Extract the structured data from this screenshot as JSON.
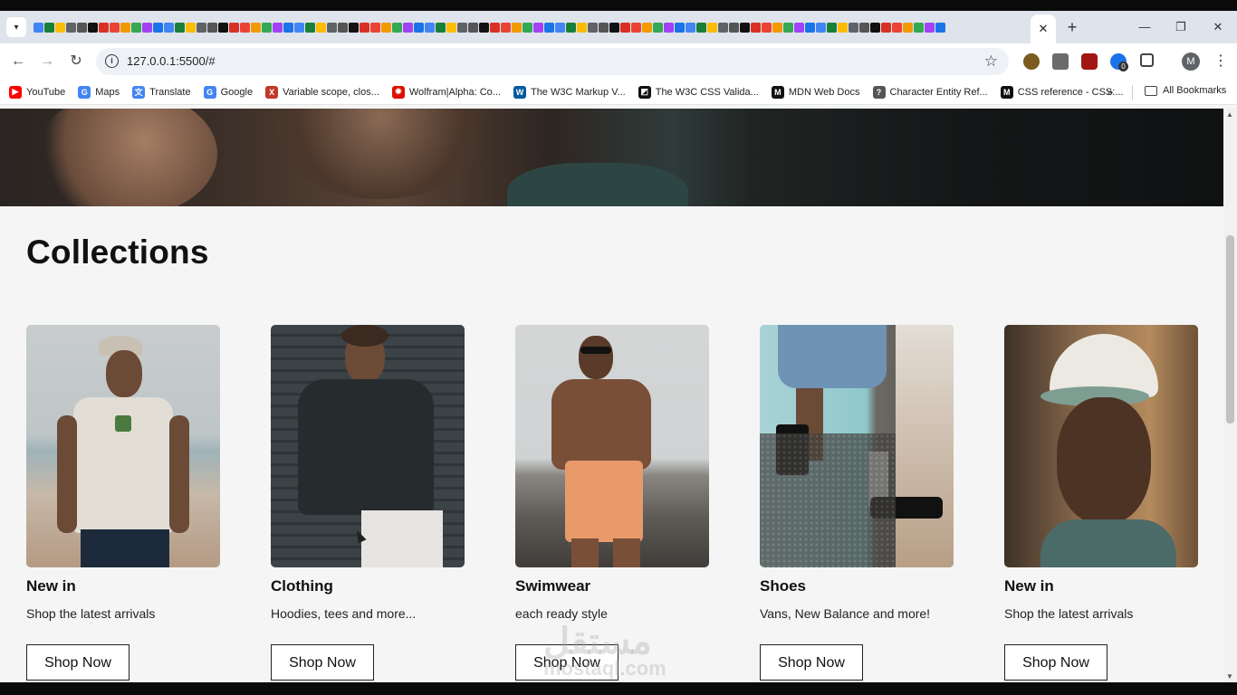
{
  "browser": {
    "active_tab_close": "✕",
    "new_tab": "+",
    "window_controls": {
      "minimize": "—",
      "restore": "❐",
      "close": "✕"
    },
    "url": "127.0.0.1:5500/#",
    "profile_initial": "M",
    "extension_badge": "0",
    "bookmarks": [
      {
        "label": "YouTube",
        "icon": "youtube-icon",
        "color": "#ff0000",
        "glyph": "▶"
      },
      {
        "label": "Maps",
        "icon": "google-maps-icon",
        "color": "#4285f4",
        "glyph": "G"
      },
      {
        "label": "Translate",
        "icon": "google-translate-icon",
        "color": "#4285f4",
        "glyph": "文"
      },
      {
        "label": "Google",
        "icon": "google-icon",
        "color": "#4285f4",
        "glyph": "G"
      },
      {
        "label": "Variable scope, clos...",
        "icon": "variable-scope-icon",
        "color": "#c0392b",
        "glyph": "X"
      },
      {
        "label": "Wolfram|Alpha: Co...",
        "icon": "wolfram-alpha-icon",
        "color": "#dd1100",
        "glyph": "✹"
      },
      {
        "label": "The W3C Markup V...",
        "icon": "w3c-icon",
        "color": "#005a9c",
        "glyph": "W"
      },
      {
        "label": "The W3C CSS Valida...",
        "icon": "w3c-css-icon",
        "color": "#111111",
        "glyph": "◩"
      },
      {
        "label": "MDN Web Docs",
        "icon": "mdn-icon",
        "color": "#111111",
        "glyph": "M"
      },
      {
        "label": "Character Entity Ref...",
        "icon": "question-circle-icon",
        "color": "#555555",
        "glyph": "?"
      },
      {
        "label": "CSS reference - CSS:...",
        "icon": "mdn-icon",
        "color": "#111111",
        "glyph": "M"
      }
    ],
    "bookmarks_more": "»",
    "all_bookmarks": "All Bookmarks"
  },
  "page": {
    "section_title": "Collections",
    "cards": [
      {
        "title": "New in",
        "description": "Shop the latest arrivals",
        "button": "Shop Now"
      },
      {
        "title": "Clothing",
        "description": "Hoodies, tees and more...",
        "button": "Shop Now"
      },
      {
        "title": "Swimwear",
        "description": "each ready style",
        "button": "Shop Now"
      },
      {
        "title": "Shoes",
        "description": "Vans, New Balance and more!",
        "button": "Shop Now"
      },
      {
        "title": "New in",
        "description": "Shop the latest arrivals",
        "button": "Shop Now"
      }
    ],
    "watermark_line1": "مستقل",
    "watermark_line2": "mostaql.com"
  }
}
